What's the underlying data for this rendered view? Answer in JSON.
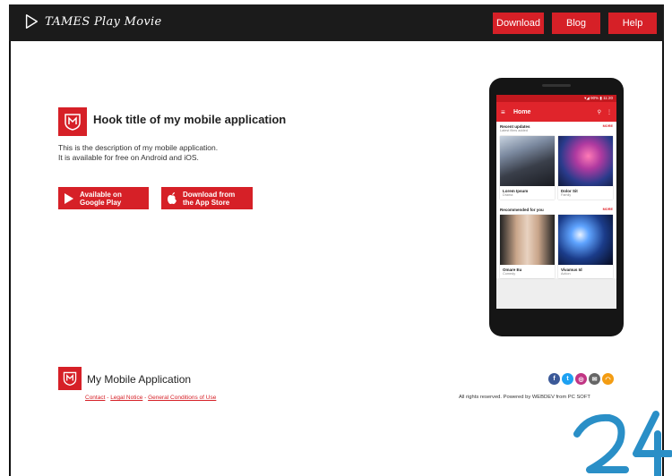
{
  "header": {
    "brand_name": "TAMES Play Movie",
    "nav": [
      {
        "label": "Download"
      },
      {
        "label": "Blog"
      },
      {
        "label": "Help"
      }
    ]
  },
  "hero": {
    "title": "Hook title of my mobile application",
    "description_line1": "This is the description of my mobile application.",
    "description_line2": "It is available for free on Android and iOS.",
    "google_play": {
      "line1": "Available on",
      "line2": "Google Play"
    },
    "app_store": {
      "line1": "Download from",
      "line2": "the App Store"
    }
  },
  "phone": {
    "status": "▾◢ 90% ▮ 11:20",
    "app_title": "Home",
    "section1": {
      "title": "Recent updates",
      "subtitle": "Latest films added",
      "more": "MORE"
    },
    "section2": {
      "title": "Recommended for you",
      "more": "MORE"
    },
    "cards": [
      {
        "title": "Lorem Ipsum",
        "subtitle": "Drama"
      },
      {
        "title": "Dolor Sit",
        "subtitle": "Family"
      },
      {
        "title": "Omare Eu",
        "subtitle": "Comedy"
      },
      {
        "title": "Vivamus Id",
        "subtitle": "Action"
      }
    ]
  },
  "footer": {
    "title": "My Mobile Application",
    "links": [
      {
        "label": "Contact"
      },
      {
        "label": "Legal Notice"
      },
      {
        "label": "General Conditions of Use"
      }
    ],
    "link_sep": " - ",
    "rights": "All rights reserved. Powered by WEBDEV from PC SOFT"
  },
  "colors": {
    "accent": "#d62027",
    "topbar": "#1b1b1b",
    "watermark": "#2a8fc7"
  },
  "icons": [
    "play-outline-icon",
    "shield-logo-icon",
    "google-play-icon",
    "apple-icon",
    "facebook-icon",
    "twitter-icon",
    "instagram-icon",
    "email-icon",
    "rss-icon",
    "hamburger-icon",
    "search-icon",
    "more-vert-icon"
  ]
}
